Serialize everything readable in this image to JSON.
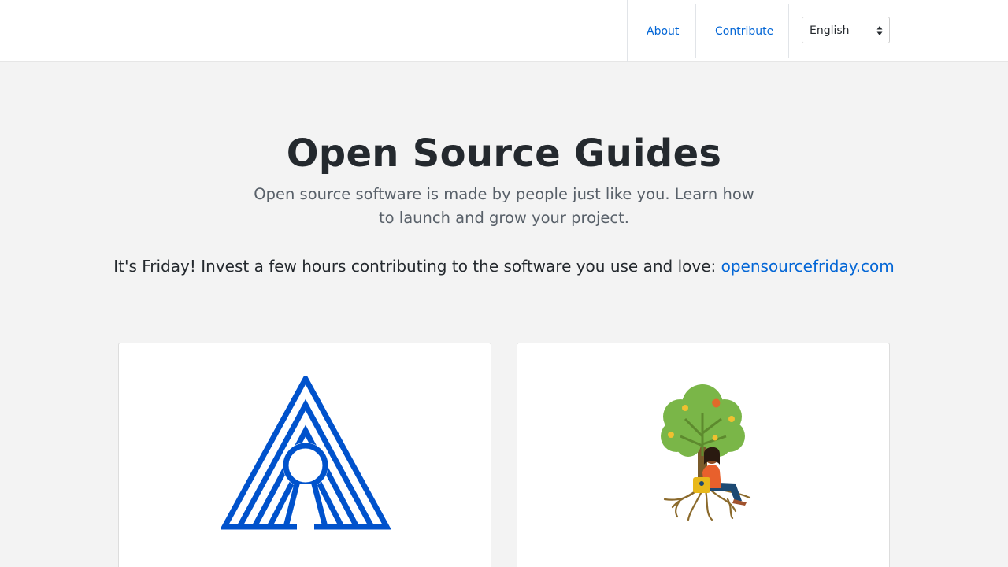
{
  "nav": {
    "about_label": "About",
    "contribute_label": "Contribute",
    "language": {
      "selected": "English"
    }
  },
  "hero": {
    "title": "Open Source Guides",
    "subtitle": "Open source software is made by people just like you. Learn how to launch and grow your project.",
    "friday_text": "It's Friday! Invest a few hours contributing to the software you use and love: ",
    "friday_link": "opensourcefriday.com"
  },
  "cards": [
    {
      "illustration": "striped-a-arch-icon"
    },
    {
      "illustration": "tree-with-person-illustration"
    }
  ],
  "colors": {
    "link": "#0366d6",
    "background": "#f3f3f3",
    "arch_blue": "#0052cc",
    "tree_green": "#7ab648"
  }
}
